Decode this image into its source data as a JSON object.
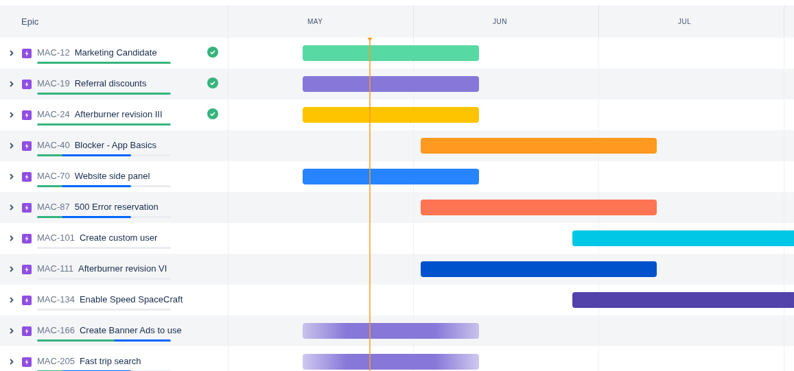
{
  "list_header": "Epic",
  "timeline": {
    "months": [
      "MAY",
      "JUN",
      "JUL"
    ]
  },
  "epics": [
    {
      "key": "MAC-12",
      "name": "Marketing Candidate",
      "done": true,
      "progress": [
        {
          "kind": "done",
          "level": 1
        }
      ],
      "bar": {
        "kind": "solid",
        "color": "#57d9a3"
      }
    },
    {
      "key": "MAC-19",
      "name": "Referral discounts",
      "done": true,
      "progress": [
        {
          "kind": "done",
          "level": 1
        }
      ],
      "bar": {
        "kind": "solid",
        "color": "#8777d9"
      }
    },
    {
      "key": "MAC-24",
      "name": "Afterburner revision III",
      "done": true,
      "progress": [
        {
          "kind": "done",
          "level": 1
        }
      ],
      "bar": {
        "kind": "solid",
        "color": "#ffc400"
      }
    },
    {
      "key": "MAC-40",
      "name": "Blocker - App Basics",
      "done": false,
      "progress": [
        {
          "kind": "in_progress",
          "level": 0.7
        },
        {
          "kind": "done",
          "level": 0.19
        }
      ],
      "bar": {
        "kind": "solid",
        "color": "#ff991f"
      }
    },
    {
      "key": "MAC-70",
      "name": "Website side panel",
      "done": false,
      "progress": [
        {
          "kind": "in_progress",
          "level": 0.7
        },
        {
          "kind": "done",
          "level": 0.19
        }
      ],
      "bar": {
        "kind": "solid",
        "color": "#2684ff"
      }
    },
    {
      "key": "MAC-87",
      "name": "500 Error reservation",
      "done": false,
      "progress": [
        {
          "kind": "in_progress",
          "level": 0.7
        },
        {
          "kind": "done",
          "level": 0.19
        }
      ],
      "bar": {
        "kind": "solid",
        "color": "#ff7452"
      }
    },
    {
      "key": "MAC-101",
      "name": "Create custom user",
      "done": false,
      "bar": {
        "kind": "solid",
        "color": "#00c7e6"
      }
    },
    {
      "key": "MAC-111",
      "name": "Afterburner revision VI",
      "done": false,
      "bar": {
        "kind": "solid",
        "color": "#0052cc"
      }
    },
    {
      "key": "MAC-134",
      "name": "Enable Speed SpaceCraft",
      "done": false,
      "bar": {
        "kind": "solid",
        "color": "#5243aa"
      }
    },
    {
      "key": "MAC-166",
      "name": "Create Banner Ads to use",
      "done": false,
      "progress": [
        {
          "kind": "in_progress",
          "level": 1
        },
        {
          "kind": "done",
          "level": 0.58
        }
      ],
      "bar": {
        "kind": "faded",
        "color": "#8777d9"
      }
    },
    {
      "key": "MAC-205",
      "name": "Fast trip search",
      "done": false,
      "progress": [
        {
          "kind": "in_progress",
          "level": 0.7
        },
        {
          "kind": "done",
          "level": 0.19
        }
      ],
      "bar": {
        "kind": "faded",
        "color": "#8777d9"
      }
    }
  ]
}
